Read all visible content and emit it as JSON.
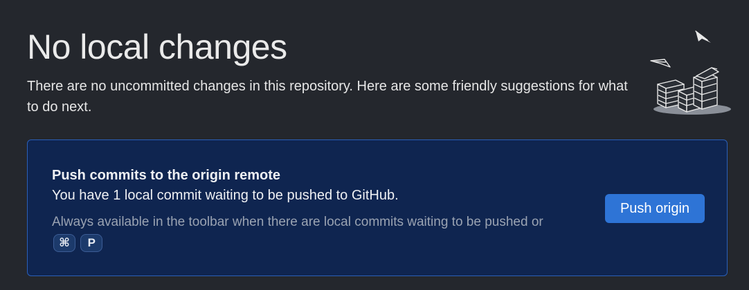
{
  "header": {
    "title": "No local changes",
    "subtitle": "There are no uncommitted changes in this repository. Here are some friendly suggestions for what to do next."
  },
  "illustration": {
    "icon": "paper-stacks-illustration"
  },
  "push_card": {
    "title": "Push commits to the origin remote",
    "description": "You have 1 local commit waiting to be pushed to GitHub.",
    "hint": "Always available in the toolbar when there are local commits waiting to be pushed or",
    "shortcut_keys": [
      "⌘",
      "P"
    ],
    "button_label": "Push origin"
  },
  "colors": {
    "background": "#24272d",
    "card_background": "#0f2550",
    "card_border": "#2a5fb8",
    "button": "#2e74d6"
  }
}
